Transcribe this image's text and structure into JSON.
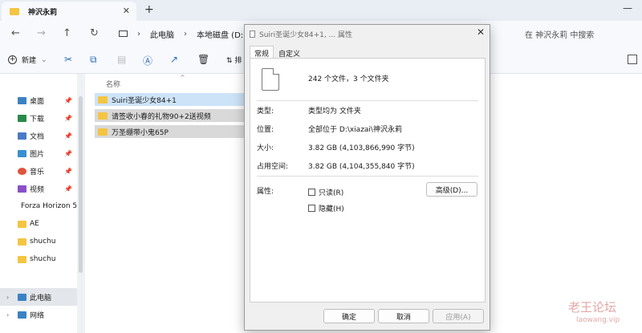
{
  "tabbar": {
    "tab_title": "神沢永莉",
    "close": "✕",
    "new_tab": "+"
  },
  "nav": {
    "back": "←",
    "forward": "→",
    "up": "↑",
    "refresh": "↻"
  },
  "breadcrumb": {
    "items": [
      "此电脑",
      "本地磁盘 (D:"
    ]
  },
  "search": {
    "placeholder": "在 神沢永莉 中搜索"
  },
  "toolbar": {
    "new_label": "新建",
    "sort_label": "排"
  },
  "sidebar": {
    "items": [
      {
        "label": "桌面",
        "color": "#3b82c4"
      },
      {
        "label": "下载",
        "color": "#2a8a4a"
      },
      {
        "label": "文档",
        "color": "#4a79c8"
      },
      {
        "label": "图片",
        "color": "#3a8fd0"
      },
      {
        "label": "音乐",
        "color": "#e0533c"
      },
      {
        "label": "视频",
        "color": "#8a4fc8"
      },
      {
        "label": "Forza Horizon 5",
        "color": "#f4c542"
      },
      {
        "label": "AE",
        "color": "#f4c542"
      },
      {
        "label": "shuchu",
        "color": "#f4c542"
      },
      {
        "label": "shuchu",
        "color": "#f4c542"
      },
      {
        "label": "此电脑",
        "color": "#3b82c4"
      },
      {
        "label": "网络",
        "color": "#3b82c4"
      }
    ]
  },
  "filelist": {
    "header": "名称",
    "rows": [
      "Suiri圣诞少女84+1",
      "请签收小春的礼物90+2送视频",
      "万圣绷带小鬼65P"
    ]
  },
  "dialog": {
    "title": "Suiri圣诞少女84+1, ... 属性",
    "tabs": [
      "常规",
      "自定义"
    ],
    "summary": "242 个文件，3 个文件夹",
    "props": [
      {
        "label": "类型:",
        "value": "类型均为 文件夹"
      },
      {
        "label": "位置:",
        "value": "全部位于 D:\\xiazai\\神沢永莉"
      },
      {
        "label": "大小:",
        "value": "3.82 GB (4,103,866,990 字节)"
      },
      {
        "label": "占用空间:",
        "value": "3.82 GB (4,104,355,840 字节)"
      }
    ],
    "attr_label": "属性:",
    "readonly_label": "只读(R)",
    "hidden_label": "隐藏(H)",
    "advanced_label": "高级(D)...",
    "ok_label": "确定",
    "cancel_label": "取消",
    "apply_label": "应用(A)"
  },
  "watermark": {
    "line1": "老王论坛",
    "line2": "laowang.vip"
  }
}
